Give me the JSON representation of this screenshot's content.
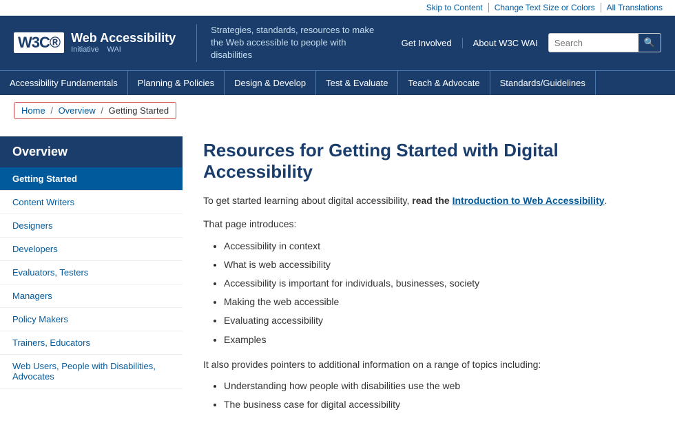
{
  "utility": {
    "skip_label": "Skip to Content",
    "text_size_label": "Change Text Size or Colors",
    "translations_label": "All Translations"
  },
  "header": {
    "w3c_logo": "W3C®",
    "initiative_label": "Web Accessibility",
    "initiative_sub1": "Initiative",
    "initiative_sub2": "WAI",
    "tagline": "Strategies, standards, resources to make the Web accessible to people with disabilities",
    "get_involved_label": "Get Involved",
    "about_label": "About W3C WAI",
    "search_placeholder": "Search",
    "search_button_label": "🔍"
  },
  "main_nav": {
    "items": [
      {
        "label": "Accessibility Fundamentals",
        "href": "#"
      },
      {
        "label": "Planning & Policies",
        "href": "#"
      },
      {
        "label": "Design & Develop",
        "href": "#"
      },
      {
        "label": "Test & Evaluate",
        "href": "#"
      },
      {
        "label": "Teach & Advocate",
        "href": "#"
      },
      {
        "label": "Standards/Guidelines",
        "href": "#"
      }
    ]
  },
  "breadcrumb": {
    "home": "Home",
    "overview": "Overview",
    "current": "Getting Started"
  },
  "sidebar": {
    "title": "Overview",
    "items": [
      {
        "label": "Getting Started",
        "active": true
      },
      {
        "label": "Content Writers"
      },
      {
        "label": "Designers"
      },
      {
        "label": "Developers"
      },
      {
        "label": "Evaluators, Testers"
      },
      {
        "label": "Managers"
      },
      {
        "label": "Policy Makers"
      },
      {
        "label": "Trainers, Educators"
      },
      {
        "label": "Web Users, People with Disabilities, Advocates"
      }
    ]
  },
  "content": {
    "title": "Resources for Getting Started with Digital Accessibility",
    "intro1_text": "To get started learning about digital accessibility,",
    "intro1_bold": "read the",
    "intro1_link": "Introduction to Web Accessibility",
    "intro1_end": ".",
    "intro2": "That page introduces:",
    "intro_bullets": [
      "Accessibility in context",
      "What is web accessibility",
      "Accessibility is important for individuals, businesses, society",
      "Making the web accessible",
      "Evaluating accessibility",
      "Examples"
    ],
    "also_text": "It also provides pointers to additional information on a range of topics including:",
    "also_bullets": [
      "Understanding how people with disabilities use the web",
      "The business case for digital accessibility"
    ]
  }
}
